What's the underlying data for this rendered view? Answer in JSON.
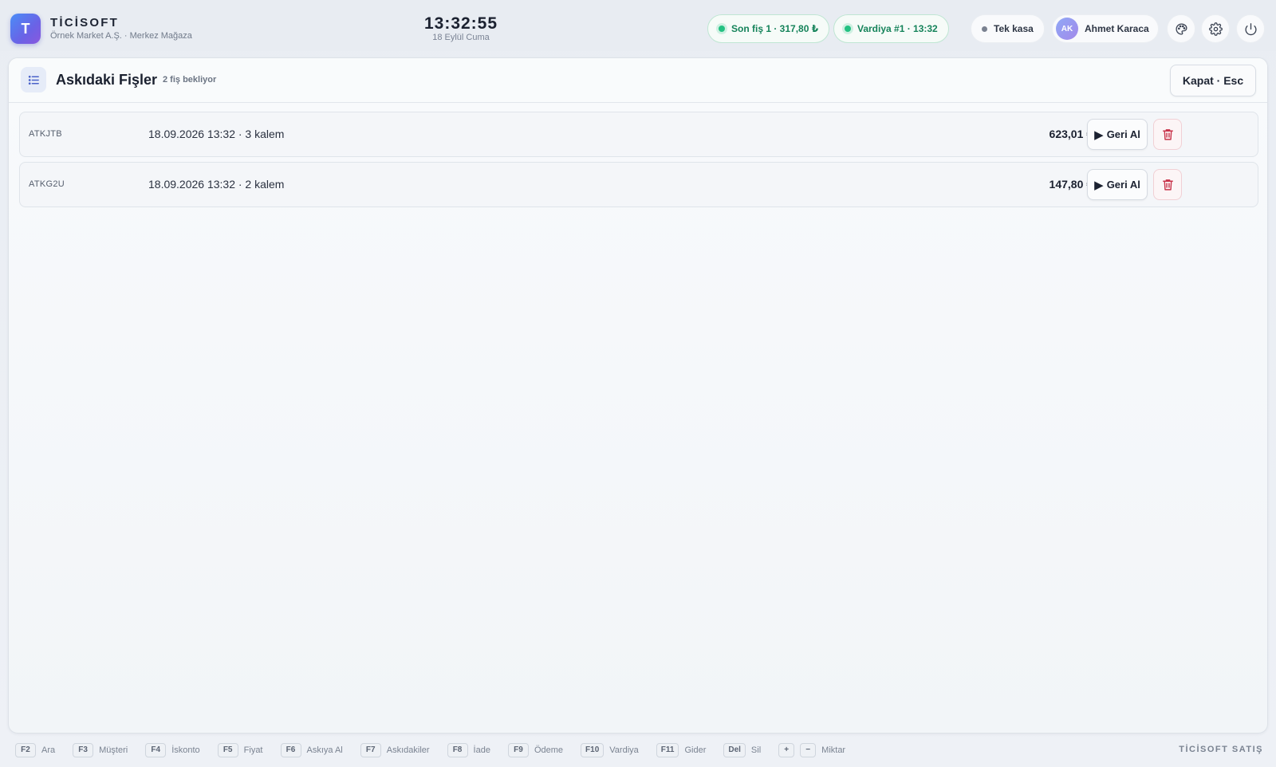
{
  "app": {
    "logo_letter": "T",
    "name": "TİCİSOFT",
    "subtitle": "Örnek Market A.Ş. · Merkez Mağaza"
  },
  "clock": {
    "time": "13:32:55",
    "date": "18 Eylül Cuma"
  },
  "status": {
    "last_receipt": "Son fiş 1 · 317,80 ₺",
    "shift": "Vardiya #1 · 13:32",
    "register": "Tek kasa"
  },
  "user": {
    "initials": "AK",
    "name": "Ahmet Karaca"
  },
  "toolbar_icons": [
    "palette-icon",
    "gear-icon",
    "power-icon"
  ],
  "panel": {
    "title": "Askıdaki Fişler",
    "badge": "2 fiş bekliyor",
    "close_label": "Kapat · Esc"
  },
  "held_receipts": [
    {
      "code": "ATKJTB",
      "info": "18.09.2026 13:32 · 3 kalem",
      "total": "623,01 ₺",
      "resume_label": "Geri Al"
    },
    {
      "code": "ATKG2U",
      "info": "18.09.2026 13:32 · 2 kalem",
      "total": "147,80 ₺",
      "resume_label": "Geri Al"
    }
  ],
  "shortcuts": [
    {
      "key": "F2",
      "label": "Ara"
    },
    {
      "key": "F3",
      "label": "Müşteri"
    },
    {
      "key": "F4",
      "label": "İskonto"
    },
    {
      "key": "F5",
      "label": "Fiyat"
    },
    {
      "key": "F6",
      "label": "Askıya Al"
    },
    {
      "key": "F7",
      "label": "Askıdakiler"
    },
    {
      "key": "F8",
      "label": "İade"
    },
    {
      "key": "F9",
      "label": "Ödeme"
    },
    {
      "key": "F10",
      "label": "Vardiya"
    },
    {
      "key": "F11",
      "label": "Gider"
    },
    {
      "key": "Del",
      "label": "Sil"
    }
  ],
  "qty_shortcut": {
    "plus": "+",
    "minus": "−",
    "label": "Miktar"
  },
  "footer_brand": "TİCİSOFT SATIŞ",
  "colors": {
    "accent": "#5b6ee8",
    "success": "#15835a",
    "danger": "#c8334a"
  }
}
